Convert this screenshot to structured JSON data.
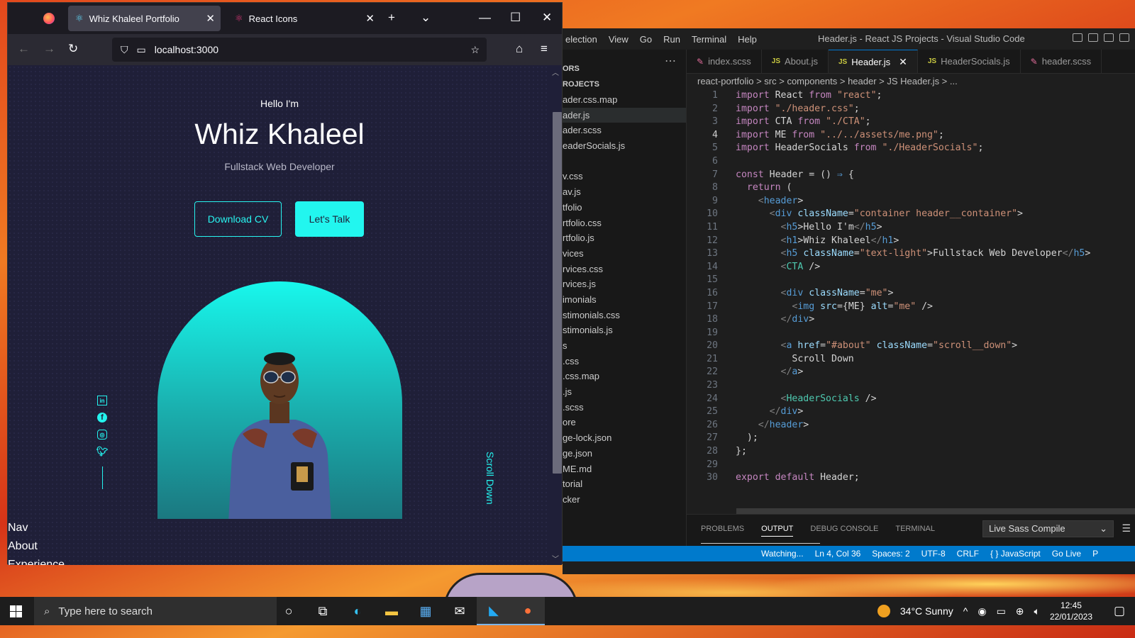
{
  "firefox": {
    "tabs": [
      {
        "label": "Whiz Khaleel Portfolio",
        "active": true
      },
      {
        "label": "React Icons",
        "active": false
      }
    ],
    "url": "localhost:3000",
    "page": {
      "hello": "Hello I'm",
      "name": "Whiz Khaleel",
      "role": "Fullstack Web Developer",
      "download_cv": "Download CV",
      "lets_talk": "Let's Talk",
      "scroll_down": "Scroll Down",
      "nav_items": [
        "Nav",
        "About",
        "Experience"
      ]
    }
  },
  "vscode": {
    "menu": [
      "election",
      "View",
      "Go",
      "Run",
      "Terminal",
      "Help"
    ],
    "title": "Header.js - React JS Projects - Visual Studio Code",
    "sidebar": {
      "header_label": "ORS",
      "section": "ROJECTS",
      "files": [
        "ader.css.map",
        "ader.js",
        "ader.scss",
        "eaderSocials.js",
        "",
        "v.css",
        "av.js",
        "tfolio",
        "rtfolio.css",
        "rtfolio.js",
        "vices",
        "rvices.css",
        "rvices.js",
        "imonials",
        "stimonials.css",
        "stimonials.js",
        "s",
        ".css",
        ".css.map",
        ".js",
        ".scss",
        "ore",
        "ge-lock.json",
        "ge.json",
        "ME.md",
        "torial",
        "cker"
      ],
      "active_index": 1
    },
    "tabs": [
      {
        "label": "index.scss",
        "kind": "scss"
      },
      {
        "label": "About.js",
        "kind": "js"
      },
      {
        "label": "Header.js",
        "kind": "js",
        "active": true
      },
      {
        "label": "HeaderSocials.js",
        "kind": "js"
      },
      {
        "label": "header.scss",
        "kind": "scss"
      }
    ],
    "breadcrumb": "react-portfolio > src > components > header > JS Header.js > ...",
    "code_lines": [
      "import React from \"react\";",
      "import \"./header.css\";",
      "import CTA from \"./CTA\";",
      "import ME from \"../../assets/me.png\";",
      "import HeaderSocials from \"./HeaderSocials\";",
      "",
      "const Header = () => {",
      "  return (",
      "    <header>",
      "      <div className=\"container header__container\">",
      "        <h5>Hello I'm</h5>",
      "        <h1>Whiz Khaleel</h1>",
      "        <h5 className=\"text-light\">Fullstack Web Developer</h5>",
      "        <CTA />",
      "",
      "        <div className=\"me\">",
      "          <img src={ME} alt=\"me\" />",
      "        </div>",
      "",
      "        <a href=\"#about\" className=\"scroll__down\">",
      "          Scroll Down",
      "        </a>",
      "",
      "        <HeaderSocials />",
      "      </div>",
      "    </header>",
      "  );",
      "};",
      "",
      "export default Header;"
    ],
    "current_line": 4,
    "panel": {
      "tabs": [
        "PROBLEMS",
        "OUTPUT",
        "DEBUG CONSOLE",
        "TERMINAL"
      ],
      "active_tab": "OUTPUT",
      "output_channel": "Live Sass Compile",
      "output_text": "Watching..."
    },
    "statusbar": [
      "Watching...",
      "Ln 4, Col 36",
      "Spaces: 2",
      "UTF-8",
      "CRLF",
      "{ } JavaScript",
      "Go Live",
      "P"
    ]
  },
  "taskbar": {
    "search_placeholder": "Type here to search",
    "weather": "34°C  Sunny",
    "time": "12:45",
    "date": "22/01/2023"
  }
}
